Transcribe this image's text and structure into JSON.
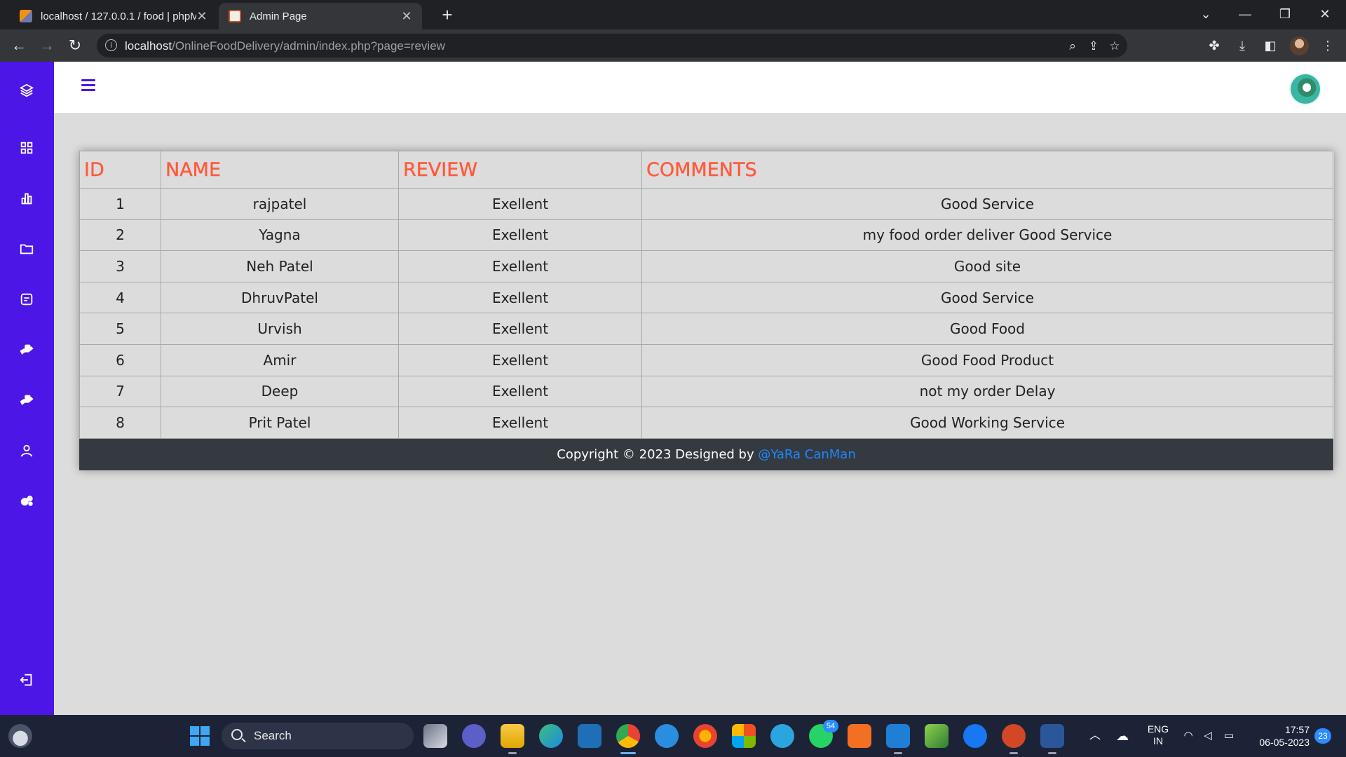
{
  "browser": {
    "tabs": [
      {
        "title": "localhost / 127.0.0.1 / food | phpMyAdmin",
        "favicon": "phpmyadmin-icon",
        "active": false
      },
      {
        "title": "Admin Page",
        "favicon": "food-site-icon",
        "active": true
      }
    ],
    "url_host": "localhost",
    "url_path": "/OnlineFoodDelivery/admin/index.php?page=review"
  },
  "sidebar": {
    "accent_color": "#4b16e6",
    "items": [
      {
        "icon": "layers-icon"
      },
      {
        "icon": "dashboard-grid-icon"
      },
      {
        "icon": "bar-chart-icon"
      },
      {
        "icon": "folder-icon"
      },
      {
        "icon": "message-icon"
      },
      {
        "icon": "delivery-hand-icon"
      },
      {
        "icon": "delivery-hand-icon"
      },
      {
        "icon": "user-icon"
      },
      {
        "icon": "settings-gears-icon"
      },
      {
        "icon": "logout-icon"
      }
    ]
  },
  "table": {
    "header_color": "#ff5a3c",
    "columns": [
      "ID",
      "NAME",
      "REVIEW",
      "COMMENTS"
    ],
    "rows": [
      {
        "id": "1",
        "name": "rajpatel",
        "review": "Exellent",
        "comments": "Good Service"
      },
      {
        "id": "2",
        "name": "Yagna",
        "review": "Exellent",
        "comments": "my food order deliver Good Service"
      },
      {
        "id": "3",
        "name": "Neh Patel",
        "review": "Exellent",
        "comments": "Good site"
      },
      {
        "id": "4",
        "name": "DhruvPatel",
        "review": "Exellent",
        "comments": "Good Service"
      },
      {
        "id": "5",
        "name": "Urvish",
        "review": "Exellent",
        "comments": "Good Food"
      },
      {
        "id": "6",
        "name": "Amir",
        "review": "Exellent",
        "comments": "Good Food Product"
      },
      {
        "id": "7",
        "name": "Deep",
        "review": "Exellent",
        "comments": "not my order Delay"
      },
      {
        "id": "8",
        "name": "Prit Patel",
        "review": "Exellent",
        "comments": "Good Working Service"
      }
    ]
  },
  "footer": {
    "text": "Copyright © 2023 Designed by ",
    "link": "@YaRa CanMan"
  },
  "taskbar": {
    "search_label": "Search",
    "whatsapp_badge": "54",
    "language": "ENG",
    "region": "IN",
    "time": "17:57",
    "date": "06-05-2023",
    "notification_count": "23"
  }
}
